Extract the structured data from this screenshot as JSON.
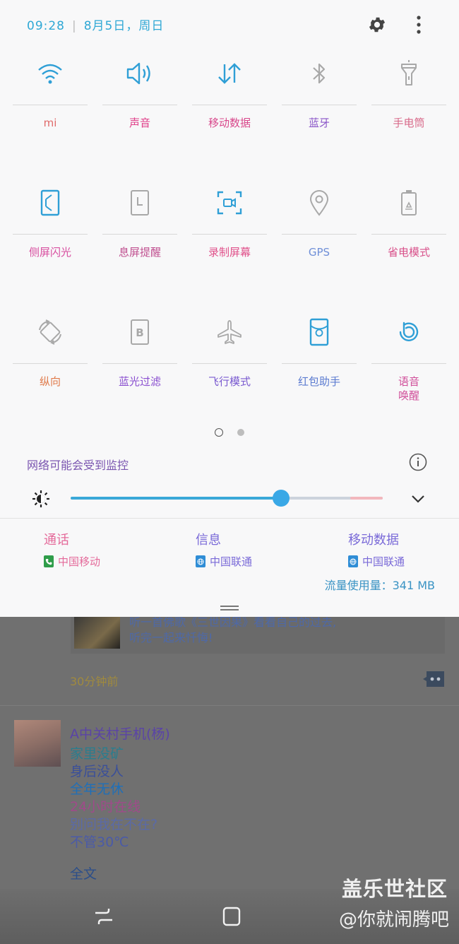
{
  "status": {
    "time": "09:28",
    "divider": "|",
    "date": "8月5日，周日"
  },
  "colors": {
    "accent": "#2fa8d5",
    "panel_bg": "#f8f8f9",
    "active_icon": "#2f9fd6",
    "inactive_icon": "#a8a8a8"
  },
  "tiles": [
    {
      "label": "mi",
      "icon": "wifi-icon",
      "active": true,
      "color": "#e06a6a"
    },
    {
      "label": "声音",
      "icon": "sound-icon",
      "active": true,
      "color": "#e0408a"
    },
    {
      "label": "移动数据",
      "icon": "mobile-data-icon",
      "active": true,
      "color": "#d8478b"
    },
    {
      "label": "蓝牙",
      "icon": "bluetooth-icon",
      "active": false,
      "color": "#8a55c8"
    },
    {
      "label": "手电筒",
      "icon": "flashlight-icon",
      "active": false,
      "color": "#d86a8a"
    },
    {
      "label": "侧屏闪光",
      "icon": "edge-lighting-icon",
      "active": true,
      "color": "#d84fa0"
    },
    {
      "label": "息屏提醒",
      "icon": "always-on-display-icon",
      "active": false,
      "color": "#c05090"
    },
    {
      "label": "录制屏幕",
      "icon": "screen-record-icon",
      "active": true,
      "color": "#e0508a"
    },
    {
      "label": "GPS",
      "icon": "location-icon",
      "active": false,
      "color": "#6f8fd8"
    },
    {
      "label": "省电模式",
      "icon": "power-saving-icon",
      "active": false,
      "color": "#d8508a"
    },
    {
      "label": "纵向",
      "icon": "auto-rotate-icon",
      "active": false,
      "color": "#e07a4a"
    },
    {
      "label": "蓝光过滤",
      "icon": "blue-light-filter-icon",
      "active": false,
      "color": "#8a4fd0"
    },
    {
      "label": "飞行模式",
      "icon": "airplane-icon",
      "active": false,
      "color": "#7a5ad0"
    },
    {
      "label": "红包助手",
      "icon": "red-packet-icon",
      "active": true,
      "color": "#5a7ad0"
    },
    {
      "label": "语音\n唤醒",
      "icon": "bixby-icon",
      "active": true,
      "color": "#d04f9a"
    }
  ],
  "network_notice": "网络可能会受到监控",
  "brightness": {
    "level": 0.674
  },
  "sim": [
    {
      "title": "通话",
      "carrier": "中国移动",
      "title_color": "#e46a9a",
      "badge_color": "#2f9d4a",
      "icon": "phone-sim-icon"
    },
    {
      "title": "信息",
      "carrier": "中国联通",
      "title_color": "#7a6ad8",
      "badge_color": "#2f8dd6",
      "icon": "globe-sim-icon"
    },
    {
      "title": "移动数据",
      "carrier": "中国联通",
      "title_color": "#7a6ad8",
      "badge_color": "#2f8dd6",
      "icon": "globe-sim-icon"
    }
  ],
  "data_usage": "流量使用量：341 MB",
  "feed": {
    "shared_text_1": "听一首佛歌《三世因果》看看自己的过去,",
    "shared_text_2": "听完一起来忏悔!",
    "time_ago": "30分钟前",
    "author": "A中关村手机(杨)",
    "lines": [
      {
        "text": "家里没矿",
        "color": "#2a7d8e"
      },
      {
        "text": "身后没人",
        "color": "#3a4f9a"
      },
      {
        "text": "全年无休",
        "color": "#1f6fb8"
      },
      {
        "text": "24小时在线",
        "color": "#a04a8a"
      },
      {
        "text": "别问我在不在?",
        "color": "#5a6aa8"
      },
      {
        "text": "不管30℃",
        "color": "#4a5aa8"
      }
    ],
    "full_text": "全文"
  },
  "watermark": {
    "line1": "盖乐世社区",
    "line2": "@你就闹腾吧"
  }
}
